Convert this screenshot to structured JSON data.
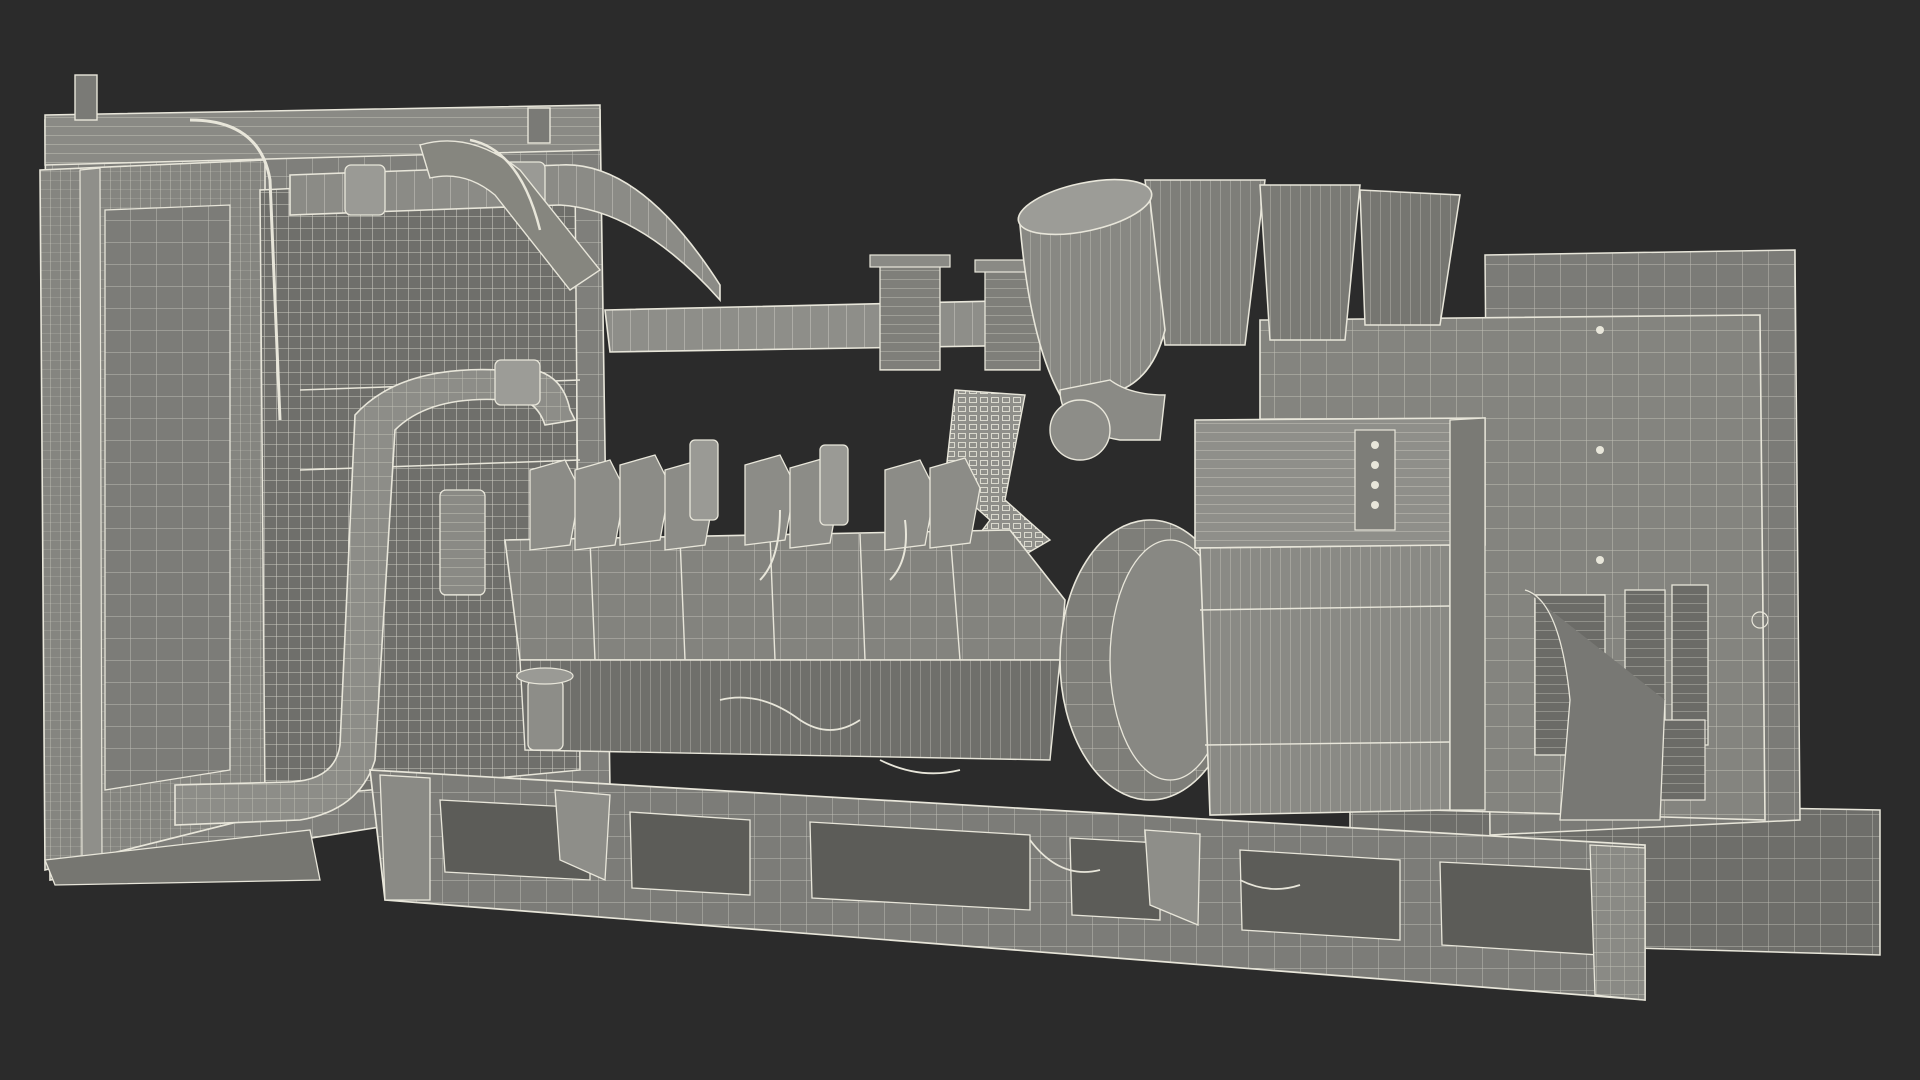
{
  "scene": {
    "subject": "diesel-generator-wireframe-render",
    "colors": {
      "background": "#2b2b2b",
      "body_fill": "#7d7d79",
      "body_dark": "#5f5f5b",
      "body_light": "#9a9a95",
      "wire": "#e8e6da",
      "wire_dim": "#c9c7bb"
    },
    "components": [
      "radiator",
      "radiator-grille",
      "coolant-pipes",
      "intake-pipe",
      "air-filter",
      "exhaust-stacks",
      "v-engine-block",
      "engine-cylinder-heads",
      "flywheel-housing",
      "alternator-housing",
      "control-box",
      "base-frame-rail"
    ]
  }
}
